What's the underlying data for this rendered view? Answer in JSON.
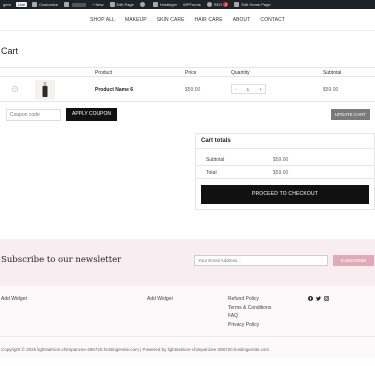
{
  "adminbar": {
    "site_label": "gers",
    "badge": "Live",
    "customize": "Customize",
    "new": "New",
    "edit_page": "Edit Page",
    "hostinger": "Hostinger",
    "wpforms": "WPForms",
    "seo": "SEO",
    "seo_count": "2",
    "edit_home": "Edit Home Page"
  },
  "nav": {
    "items": [
      "SHOP ALL",
      "MAKEUP",
      "SKIN CARE",
      "HAIR CARE",
      "ABOUT",
      "CONTACT"
    ]
  },
  "page": {
    "title": "Cart"
  },
  "cart": {
    "headers": {
      "product": "Product",
      "price": "Price",
      "quantity": "Quantity",
      "subtotal": "Subtotal"
    },
    "rows": [
      {
        "name": "Product Name 6",
        "price": "$59.00",
        "quantity": "1",
        "subtotal": "$59.00"
      }
    ],
    "remove_icon": "×",
    "qty_minus": "-",
    "qty_plus": "+",
    "coupon_placeholder": "Coupon code",
    "apply_label": "APPLY COUPON",
    "update_label": "UPDATE CART"
  },
  "totals": {
    "title": "Cart totals",
    "subtotal_label": "Subtotal",
    "subtotal_value": "$59.00",
    "total_label": "Total",
    "total_value": "$59.00",
    "checkout_label": "PROCEED TO CHECKOUT"
  },
  "newsletter": {
    "title": "Subscribe to our newsletter",
    "email_placeholder": "Your Email Address...",
    "subscribe_label": "SUBSCRIBE"
  },
  "footer": {
    "widget1": "Add Widget",
    "widget2": "Add Widget",
    "links": [
      "Refund Policy",
      "Terms & Conditions",
      "FAQ",
      "Privacy Policy"
    ],
    "social_icons": [
      "facebook-icon",
      "twitter-icon",
      "instagram-icon"
    ],
    "copyright": "Copyright © 2025 lightsalmon-chimpanzee-286720.hostingersite.com | Powered by lightsalmon-chimpanzee-286720.hostingersite.com"
  },
  "colors": {
    "adminbar": "#1d2327",
    "button_dark": "#111111",
    "newsletter_bg": "#f8eef1",
    "subscribe": "#e2a9b8"
  }
}
